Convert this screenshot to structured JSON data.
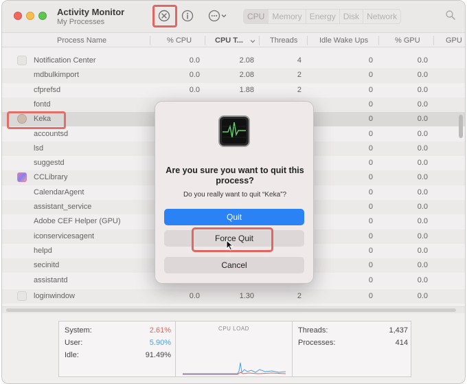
{
  "window": {
    "title": "Activity Monitor",
    "subtitle": "My Processes"
  },
  "toolbar": {
    "stop_icon": "x-circle-icon",
    "info_icon": "info-icon",
    "more_icon": "ellipsis-circle-icon"
  },
  "tabs": [
    "CPU",
    "Memory",
    "Energy",
    "Disk",
    "Network"
  ],
  "columns": [
    "Process Name",
    "% CPU",
    "CPU T...",
    "Threads",
    "Idle Wake Ups",
    "% GPU",
    "GPU"
  ],
  "rows": [
    {
      "name": "Notification Center",
      "cpu": "0.0",
      "time": "2.08",
      "threads": "4",
      "idle": "0",
      "gpu": "0.0"
    },
    {
      "name": "mdbulkimport",
      "cpu": "0.0",
      "time": "2.08",
      "threads": "2",
      "idle": "0",
      "gpu": "0.0"
    },
    {
      "name": "cfprefsd",
      "cpu": "0.0",
      "time": "1.88",
      "threads": "2",
      "idle": "0",
      "gpu": "0.0"
    },
    {
      "name": "fontd",
      "cpu": "",
      "time": "",
      "threads": "",
      "idle": "0",
      "gpu": "0.0"
    },
    {
      "name": "Keka",
      "cpu": "",
      "time": "",
      "threads": "",
      "idle": "0",
      "gpu": "0.0"
    },
    {
      "name": "accountsd",
      "cpu": "",
      "time": "",
      "threads": "",
      "idle": "0",
      "gpu": "0.0"
    },
    {
      "name": "lsd",
      "cpu": "",
      "time": "",
      "threads": "",
      "idle": "0",
      "gpu": "0.0"
    },
    {
      "name": "suggestd",
      "cpu": "",
      "time": "",
      "threads": "",
      "idle": "0",
      "gpu": "0.0"
    },
    {
      "name": "CCLibrary",
      "cpu": "",
      "time": "",
      "threads": "",
      "idle": "0",
      "gpu": "0.0"
    },
    {
      "name": "CalendarAgent",
      "cpu": "",
      "time": "",
      "threads": "",
      "idle": "0",
      "gpu": "0.0"
    },
    {
      "name": "assistant_service",
      "cpu": "",
      "time": "",
      "threads": "",
      "idle": "0",
      "gpu": "0.0"
    },
    {
      "name": "Adobe CEF Helper (GPU)",
      "cpu": "",
      "time": "",
      "threads": "",
      "idle": "0",
      "gpu": "0.0"
    },
    {
      "name": "iconservicesagent",
      "cpu": "",
      "time": "",
      "threads": "",
      "idle": "0",
      "gpu": "0.0"
    },
    {
      "name": "helpd",
      "cpu": "",
      "time": "",
      "threads": "",
      "idle": "0",
      "gpu": "0.0"
    },
    {
      "name": "secinitd",
      "cpu": "",
      "time": "",
      "threads": "",
      "idle": "0",
      "gpu": "0.0"
    },
    {
      "name": "assistantd",
      "cpu": "",
      "time": "",
      "threads": "",
      "idle": "0",
      "gpu": "0.0"
    },
    {
      "name": "loginwindow",
      "cpu": "0.0",
      "time": "1.30",
      "threads": "2",
      "idle": "0",
      "gpu": "0.0"
    }
  ],
  "stats": {
    "system_label": "System:",
    "system_value": "2.61%",
    "user_label": "User:",
    "user_value": "5.90%",
    "idle_label": "Idle:",
    "idle_value": "91.49%",
    "load_title": "CPU LOAD",
    "threads_label": "Threads:",
    "threads_value": "1,437",
    "processes_label": "Processes:",
    "processes_value": "414"
  },
  "dialog": {
    "title": "Are you sure you want to quit this process?",
    "message": "Do you really want to quit “Keka”?",
    "quit": "Quit",
    "force_quit": "Force Quit",
    "cancel": "Cancel"
  },
  "colors": {
    "system_value": "#e0665f",
    "user_value": "#4a9fe0",
    "quit_button": "#2a82f5",
    "highlight": "#e0665f"
  }
}
